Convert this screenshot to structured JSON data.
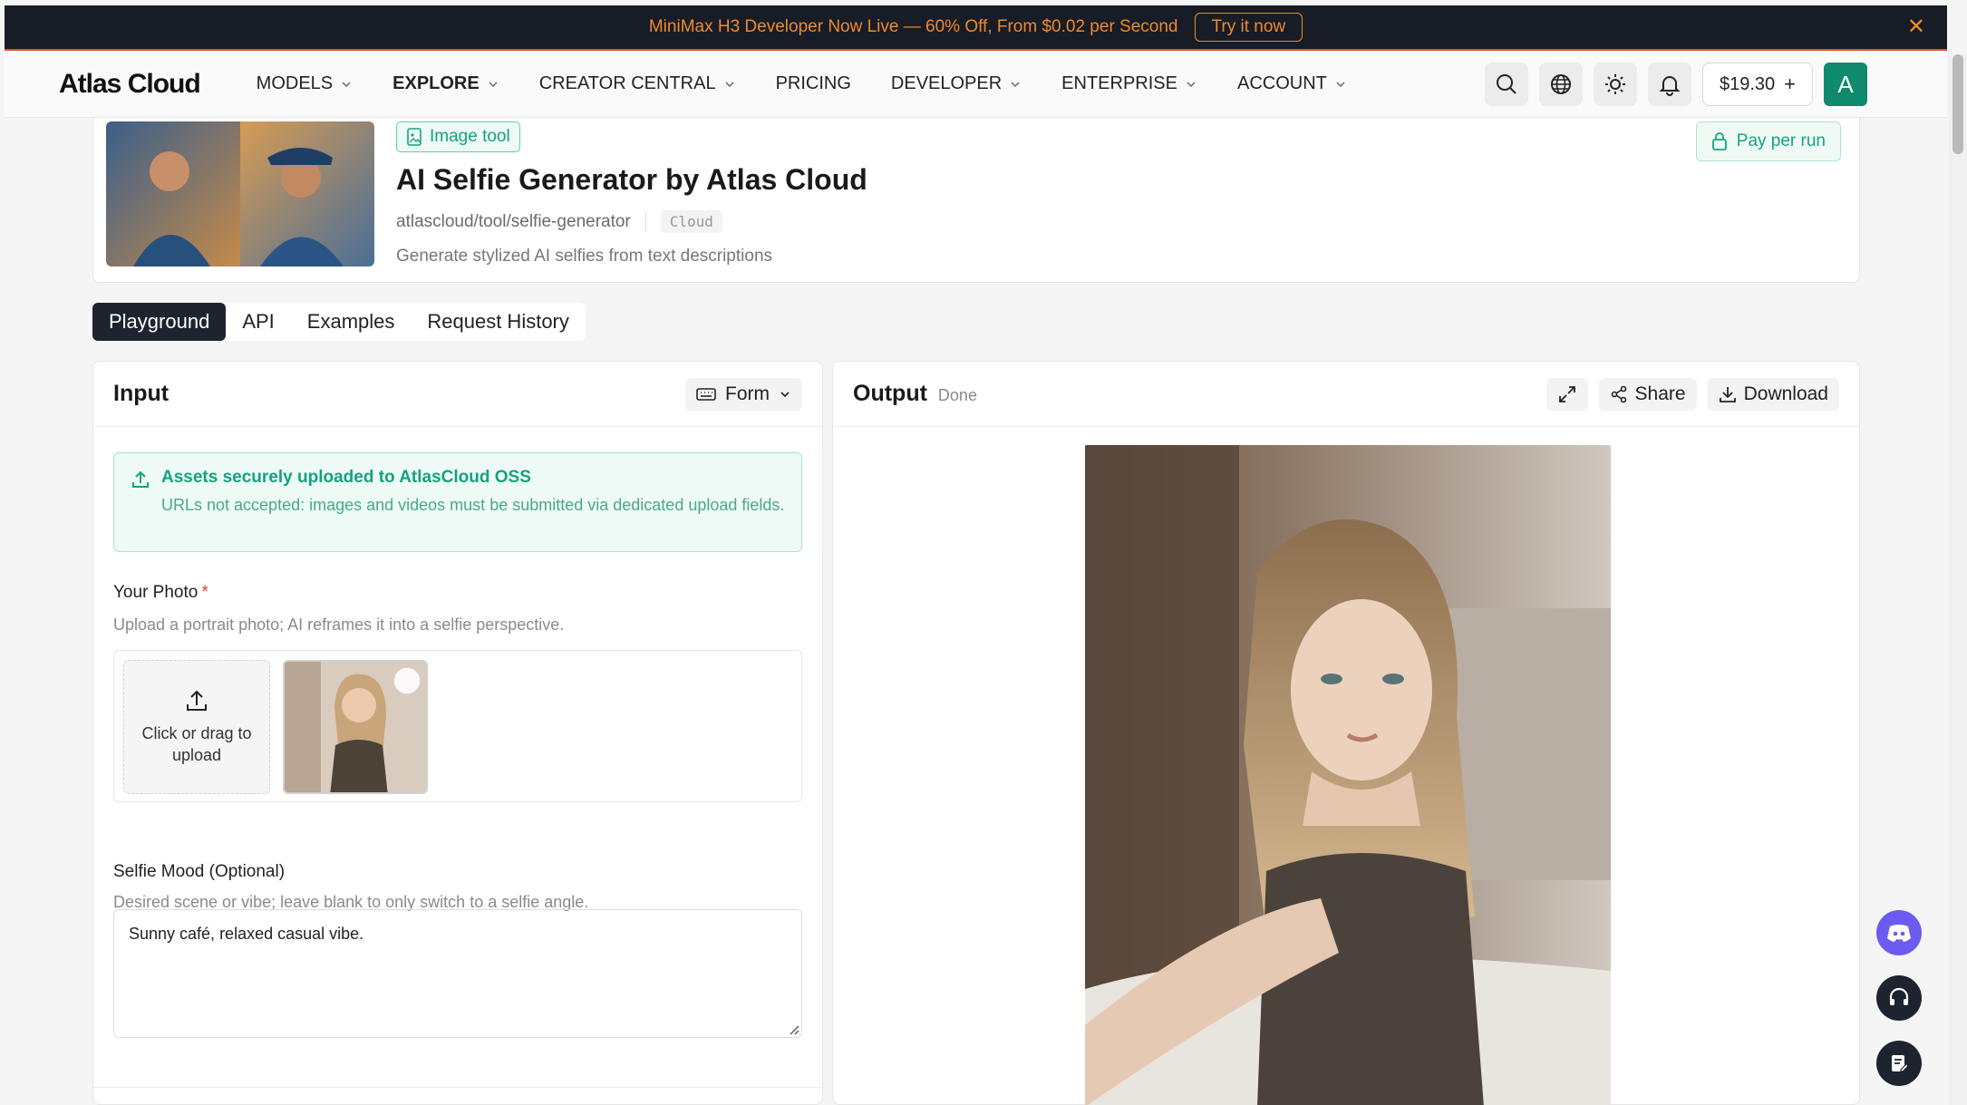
{
  "announcement": {
    "text": "MiniMax H3 Developer Now Live — 60% Off, From $0.02 per Second",
    "cta": "Try it now",
    "close_icon": "close-icon"
  },
  "nav": {
    "logo": "Atlas Cloud",
    "items": [
      {
        "label": "MODELS",
        "dropdown": true,
        "active": false
      },
      {
        "label": "EXPLORE",
        "dropdown": true,
        "active": true
      },
      {
        "label": "CREATOR CENTRAL",
        "dropdown": true,
        "active": false
      },
      {
        "label": "PRICING",
        "dropdown": false,
        "active": false
      },
      {
        "label": "DEVELOPER",
        "dropdown": true,
        "active": false
      },
      {
        "label": "ENTERPRISE",
        "dropdown": true,
        "active": false
      },
      {
        "label": "ACCOUNT",
        "dropdown": true,
        "active": false
      }
    ],
    "balance": "$19.30",
    "balance_plus": "+",
    "avatar_letter": "A",
    "icons": [
      "search-icon",
      "globe-icon",
      "sun-icon",
      "bell-icon"
    ]
  },
  "tool": {
    "tag": "Image tool",
    "title": "AI Selfie Generator by Atlas Cloud",
    "path": "atlascloud/tool/selfie-generator",
    "badge": "Cloud",
    "description": "Generate stylized AI selfies from text descriptions",
    "pay_label": "Pay per run"
  },
  "tabs": [
    {
      "label": "Playground",
      "active": true
    },
    {
      "label": "API",
      "active": false
    },
    {
      "label": "Examples",
      "active": false
    },
    {
      "label": "Request History",
      "active": false
    }
  ],
  "input": {
    "title": "Input",
    "mode": "Form",
    "notice_title": "Assets securely uploaded to AtlasCloud OSS",
    "notice_body": "URLs not accepted: images and videos must be submitted via dedicated upload fields.",
    "photo_label": "Your Photo",
    "photo_required": "*",
    "photo_help": "Upload a portrait photo; AI reframes it into a selfie perspective.",
    "upload_label": "Click or drag to upload",
    "mood_label": "Selfie Mood (Optional)",
    "mood_help": "Desired scene or vibe; leave blank to only switch to a selfie angle.",
    "mood_value": "Sunny café, relaxed casual vibe."
  },
  "output": {
    "title": "Output",
    "status": "Done",
    "share": "Share",
    "download": "Download"
  },
  "colors": {
    "accent": "#14a37f",
    "announce_bg": "#171c26",
    "announce_fg": "#f08a2a",
    "dark_tab": "#1d2430",
    "discord": "#6b5bf0"
  }
}
